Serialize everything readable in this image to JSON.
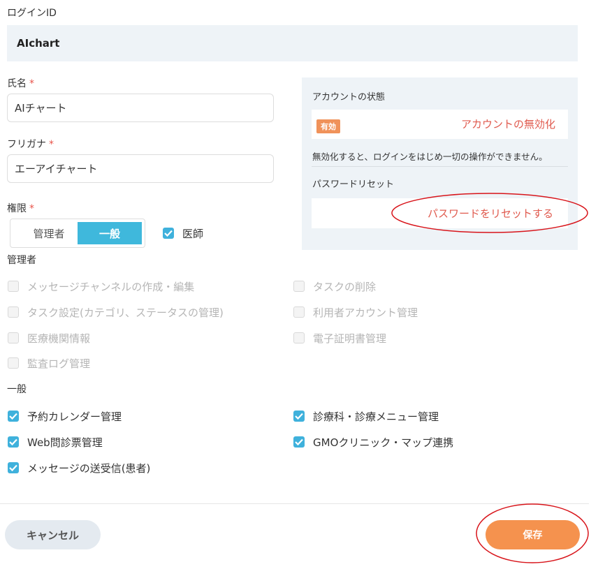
{
  "login": {
    "label": "ログインID",
    "value": "AIchart"
  },
  "name": {
    "label": "氏名",
    "required_mark": "*",
    "value": "AIチャート"
  },
  "furigana": {
    "label": "フリガナ",
    "required_mark": "*",
    "value": "エーアイチャート"
  },
  "role": {
    "label": "権限",
    "required_mark": "*",
    "options": [
      "管理者",
      "一般"
    ],
    "selected": "一般",
    "doctor_label": "医師",
    "doctor_checked": true
  },
  "account_panel": {
    "status_title": "アカウントの状態",
    "status_badge": "有効",
    "disable_link": "アカウントの無効化",
    "disable_note": "無効化すると、ログインをはじめ一切の操作ができません。",
    "reset_title": "パスワードリセット",
    "reset_link": "パスワードをリセットする"
  },
  "admin_section": {
    "title": "管理者",
    "left": [
      "メッセージチャンネルの作成・編集",
      "タスク設定(カテゴリ、ステータスの管理)",
      "医療機関情報",
      "監査ログ管理"
    ],
    "right": [
      "タスクの削除",
      "利用者アカウント管理",
      "電子証明書管理"
    ]
  },
  "general_section": {
    "title": "一般",
    "left": [
      "予約カレンダー管理",
      "Web問診票管理",
      "メッセージの送受信(患者)"
    ],
    "right": [
      "診療科・診療メニュー管理",
      "GMOクリニック・マップ連携"
    ]
  },
  "footer": {
    "cancel": "キャンセル",
    "save": "保存"
  },
  "colors": {
    "accent_orange": "#f5924e",
    "checkbox_blue": "#3fb1dc",
    "link_red": "#e05a4e",
    "annotation_red": "#d8141a"
  }
}
